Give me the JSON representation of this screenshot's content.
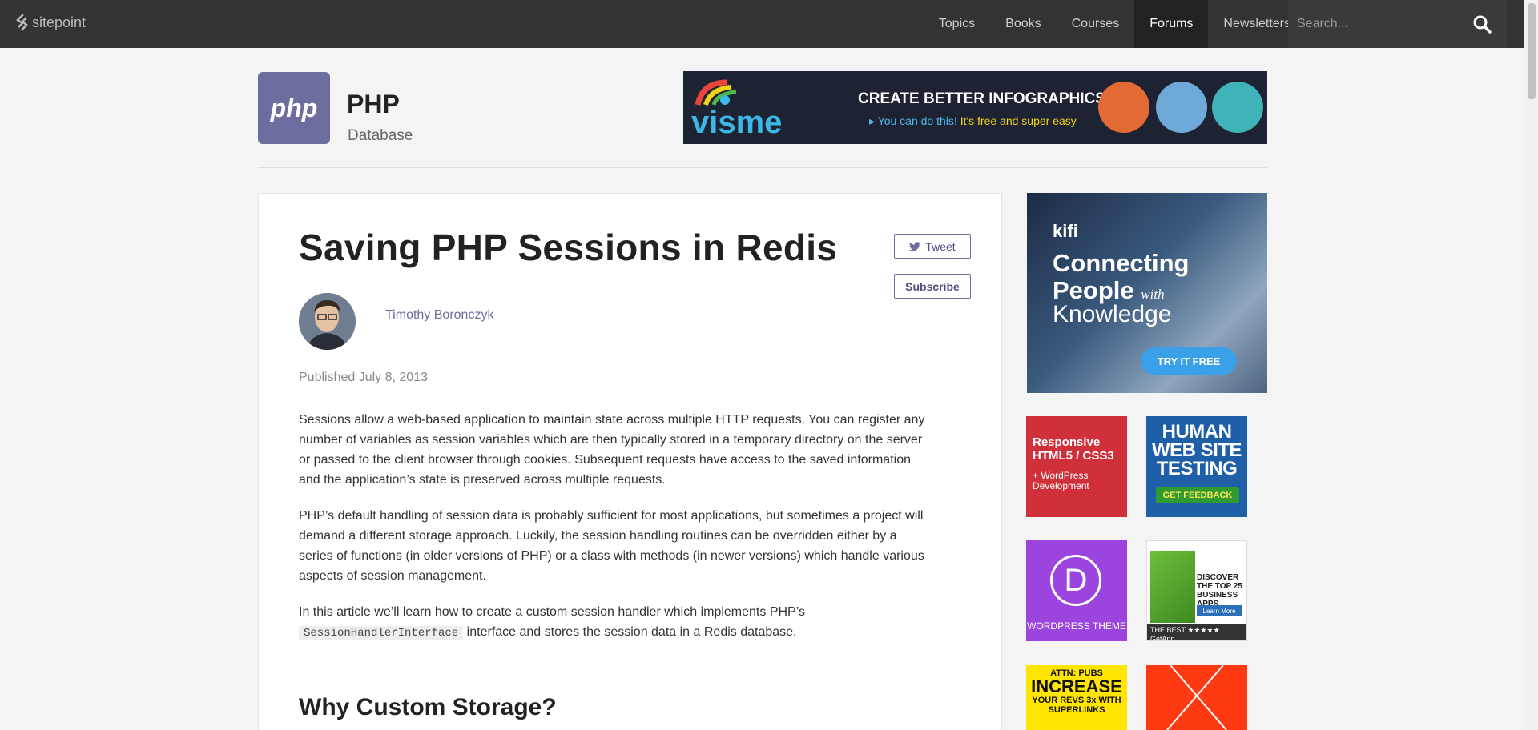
{
  "nav": {
    "logo_text": "sitepoint",
    "items": [
      {
        "label": "Topics",
        "active": false
      },
      {
        "label": "Books",
        "active": false
      },
      {
        "label": "Courses",
        "active": false
      },
      {
        "label": "Forums",
        "active": true
      },
      {
        "label": "Newsletters",
        "active": false
      }
    ],
    "search_placeholder": "Search...",
    "search_icon": "search-icon"
  },
  "category": {
    "badge": "php",
    "title": "PHP",
    "subtitle": "Database"
  },
  "banner": {
    "brand": "visme",
    "headline": "CREATE BETTER INFOGRAPHICS",
    "sub_blue": "You can do this!",
    "sub_yellow": "It's free and super easy"
  },
  "article": {
    "title": "Saving PHP Sessions in Redis",
    "tweet_label": "Tweet",
    "subscribe_label": "Subscribe",
    "author": "Timothy Boronczyk",
    "published": "Published July 8, 2013",
    "p1": "Sessions allow a web-based application to maintain state across multiple HTTP requests. You can register any number of variables as session variables which are then typically stored in a temporary directory on the server or passed to the client browser through cookies. Subsequent requests have access to the saved information and the application’s state is preserved across multiple requests.",
    "p2": "PHP’s default handling of session data is probably sufficient for most applications, but sometimes a project will demand a different storage approach. Luckily, the session handling routines can be overridden either by a series of functions (in older versions of PHP) or a class with methods (in newer versions) which handle various aspects of session management.",
    "p3_before": "In this article we’ll learn how to create a custom session handler which implements PHP’s ",
    "p3_code": "SessionHandlerInterface",
    "p3_after": " interface and stores the session data in a Redis database.",
    "h2": "Why Custom Storage?"
  },
  "ads": {
    "kifi": {
      "brand": "kifi",
      "line1": "Connecting",
      "line2": "People",
      "with": "with",
      "line3": "Knowledge",
      "cta": "TRY IT FREE"
    },
    "responsive": {
      "line1": "Responsive HTML5 / CSS3",
      "line2": "+ WordPress Development"
    },
    "human": {
      "title": "HUMAN WEB SITE TESTING",
      "cta": "GET FEEDBACK"
    },
    "wordpress": {
      "glyph": "D",
      "label": "WORDPRESS THEME"
    },
    "getapp": {
      "text": "DISCOVER THE TOP 25 BUSINESS APPS",
      "learn": "Learn More",
      "bar": "THE BEST ★★★★★  GetApp"
    },
    "attn": {
      "l1": "ATTN: PUBS",
      "l2": "INCREASE",
      "l3": "YOUR REVS 3x WITH SUPERLINKS"
    }
  },
  "colors": {
    "nav_bg": "#333333",
    "accent": "#6c6ea0",
    "page_bg": "#f4f4f4"
  }
}
